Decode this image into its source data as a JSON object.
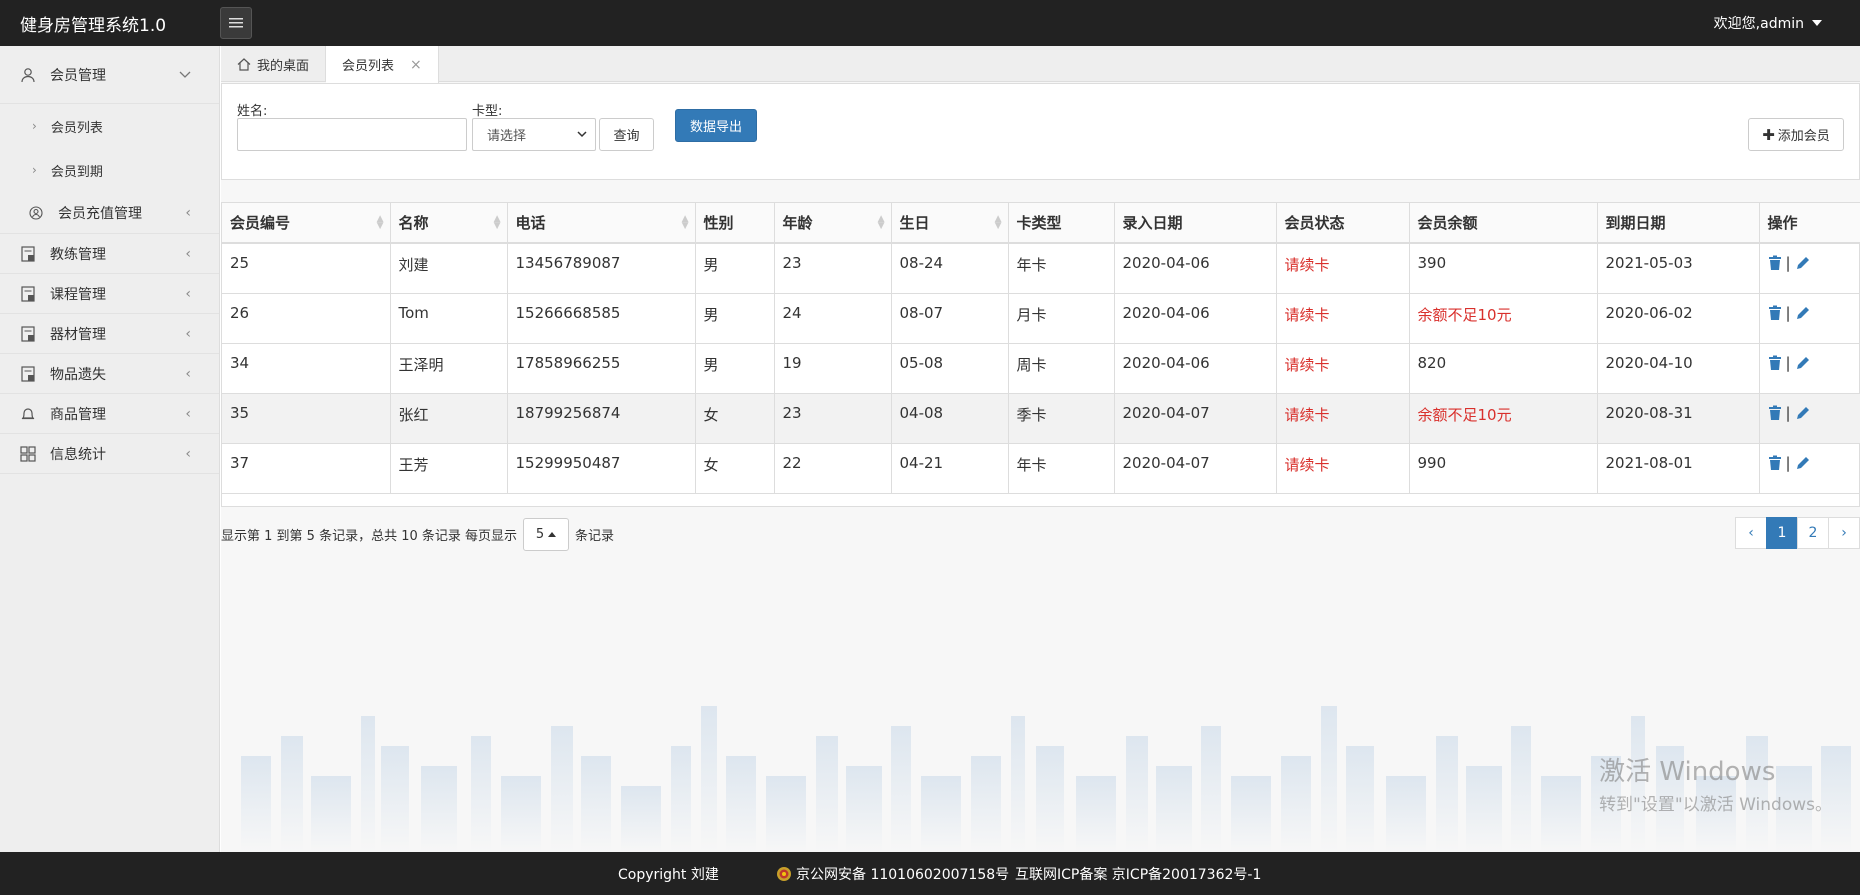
{
  "app": {
    "brand": "健身房管理系统1.0",
    "welcome": "欢迎您,admin"
  },
  "sidebar": {
    "member_mgmt": "会员管理",
    "member_list": "会员列表",
    "member_expire": "会员到期",
    "recharge_mgmt": "会员充值管理",
    "coach_mgmt": "教练管理",
    "course_mgmt": "课程管理",
    "equipment_mgmt": "器材管理",
    "lost_mgmt": "物品遗失",
    "goods_mgmt": "商品管理",
    "stats": "信息统计"
  },
  "tabs": {
    "desktop": "我的桌面",
    "member_list": "会员列表",
    "close": "×"
  },
  "search": {
    "name_label": "姓名:",
    "card_label": "卡型:",
    "card_select": "请选择",
    "query_btn": "查询",
    "export_btn": "数据导出",
    "add_btn": "添加会员"
  },
  "table": {
    "headers": [
      "会员编号",
      "名称",
      "电话",
      "性别",
      "年龄",
      "生日",
      "卡类型",
      "录入日期",
      "会员状态",
      "会员余额",
      "到期日期",
      "操作"
    ],
    "rows": [
      {
        "id": "25",
        "name": "刘建",
        "phone": "13456789087",
        "gender": "男",
        "age": "23",
        "birthday": "08-24",
        "card": "年卡",
        "date": "2020-04-06",
        "status": "请续卡",
        "balance": "390",
        "expire": "2021-05-03"
      },
      {
        "id": "26",
        "name": "Tom",
        "phone": "15266668585",
        "gender": "男",
        "age": "24",
        "birthday": "08-07",
        "card": "月卡",
        "date": "2020-04-06",
        "status": "请续卡",
        "balance": "余额不足10元",
        "expire": "2020-06-02"
      },
      {
        "id": "34",
        "name": "王泽明",
        "phone": "17858966255",
        "gender": "男",
        "age": "19",
        "birthday": "05-08",
        "card": "周卡",
        "date": "2020-04-06",
        "status": "请续卡",
        "balance": "820",
        "expire": "2020-04-10"
      },
      {
        "id": "35",
        "name": "张红",
        "phone": "18799256874",
        "gender": "女",
        "age": "23",
        "birthday": "04-08",
        "card": "季卡",
        "date": "2020-04-07",
        "status": "请续卡",
        "balance": "余额不足10元",
        "expire": "2020-08-31"
      },
      {
        "id": "37",
        "name": "王芳",
        "phone": "15299950487",
        "gender": "女",
        "age": "22",
        "birthday": "04-21",
        "card": "年卡",
        "date": "2020-04-07",
        "status": "请续卡",
        "balance": "990",
        "expire": "2021-08-01"
      }
    ],
    "op_separator": "|"
  },
  "pager": {
    "info": "显示第 1 到第 5 条记录，总共 10 条记录 每页显示",
    "page_size": "5",
    "suffix": "条记录",
    "prev": "‹",
    "page1": "1",
    "page2": "2",
    "next": "›"
  },
  "watermark": {
    "line1": "激活 Windows",
    "line2": "转到\"设置\"以激活 Windows。"
  },
  "footer": {
    "copyright": "Copyright 刘建",
    "police": "京公网安备 11010602007158号",
    "icp": "互联网ICP备案 京ICP备20017362号-1"
  },
  "colors": {
    "topbar": "#222222",
    "primary": "#337ab7",
    "warning_text": "#d9302c",
    "action_icon": "#337ab7"
  },
  "icons": {
    "menu_toggle": "hamburger-icon",
    "member": "user-icon",
    "recharge": "user-circle-icon",
    "coach": "doc-icon",
    "course": "doc-icon",
    "equipment": "doc-icon",
    "lost": "doc-icon",
    "goods": "bell-icon",
    "stats": "grid-icon",
    "delete": "trash-icon",
    "edit": "pencil-icon"
  }
}
